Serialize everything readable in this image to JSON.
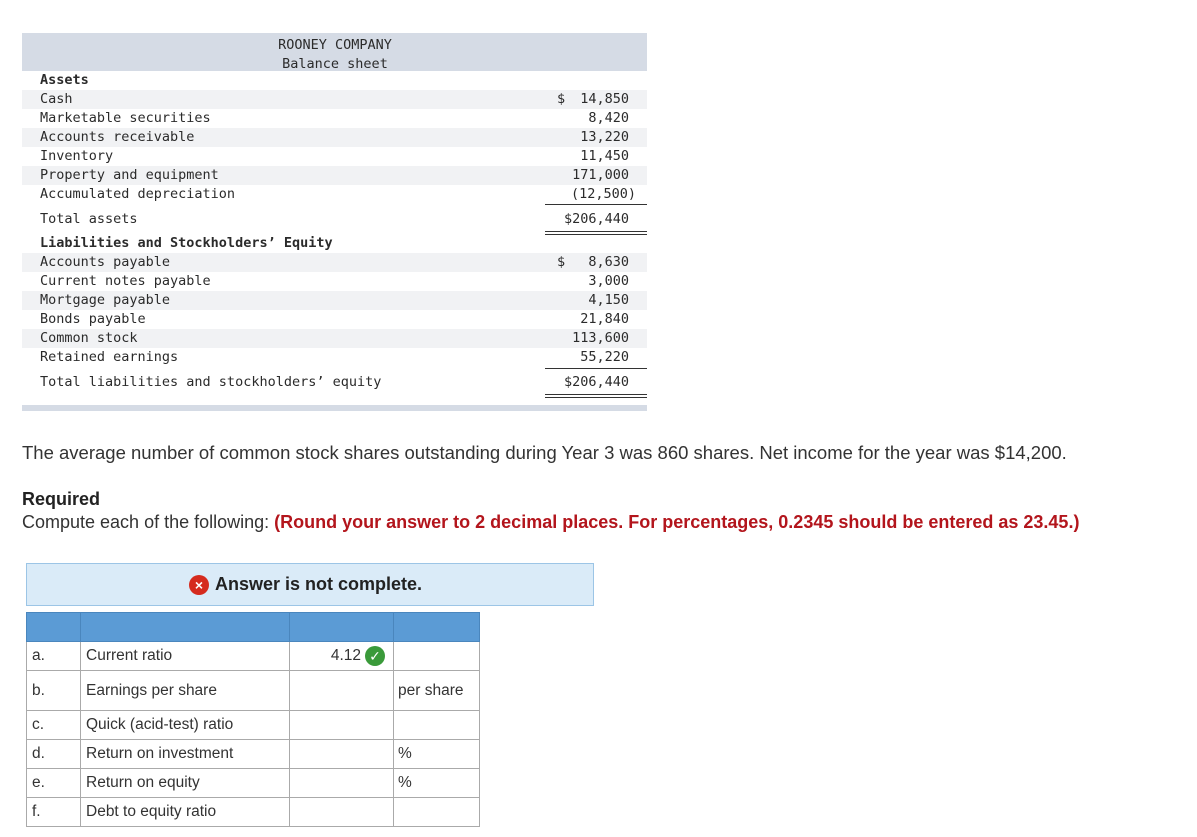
{
  "balance_sheet": {
    "company": "ROONEY COMPANY",
    "subtitle": "Balance sheet",
    "assets_heading": "Assets",
    "assets": [
      {
        "label": "Cash",
        "currency": "$",
        "amount": "14,850"
      },
      {
        "label": "Marketable securities",
        "currency": "",
        "amount": "8,420"
      },
      {
        "label": "Accounts receivable",
        "currency": "",
        "amount": "13,220"
      },
      {
        "label": "Inventory",
        "currency": "",
        "amount": "11,450"
      },
      {
        "label": "Property and equipment",
        "currency": "",
        "amount": "171,000"
      },
      {
        "label": "Accumulated depreciation",
        "currency": "",
        "amount": "(12,500)"
      }
    ],
    "total_assets": {
      "label": "Total assets",
      "amount": "$206,440"
    },
    "liab_heading": "Liabilities and Stockholders’ Equity",
    "liabilities": [
      {
        "label": "Accounts payable",
        "currency": "$",
        "amount": "8,630"
      },
      {
        "label": "Current notes payable",
        "currency": "",
        "amount": "3,000"
      },
      {
        "label": "Mortgage payable",
        "currency": "",
        "amount": "4,150"
      },
      {
        "label": "Bonds payable",
        "currency": "",
        "amount": "21,840"
      },
      {
        "label": "Common stock",
        "currency": "",
        "amount": "113,600"
      },
      {
        "label": "Retained earnings",
        "currency": "",
        "amount": "55,220"
      }
    ],
    "total_liab": {
      "label": "Total liabilities and stockholders’ equity",
      "amount": "$206,440"
    }
  },
  "problem": {
    "paragraph": "The average number of common stock shares outstanding during Year 3 was 860 shares. Net income for the year was $14,200.",
    "required_heading": "Required",
    "required_text": "Compute each of the following: ",
    "required_note": "(Round your answer to 2 decimal places. For percentages, 0.2345 should be entered as 23.45.)"
  },
  "answer": {
    "status": "Answer is not complete.",
    "x_icon": "×",
    "check_icon": "✓",
    "rows": [
      {
        "letter": "a.",
        "name": "Current ratio",
        "value": "4.12",
        "unit": "",
        "correct": true
      },
      {
        "letter": "b.",
        "name": "Earnings per share",
        "value": "",
        "unit": "per share",
        "correct": false
      },
      {
        "letter": "c.",
        "name": "Quick (acid-test) ratio",
        "value": "",
        "unit": "",
        "correct": false
      },
      {
        "letter": "d.",
        "name": "Return on investment",
        "value": "",
        "unit": "%",
        "correct": false
      },
      {
        "letter": "e.",
        "name": "Return on equity",
        "value": "",
        "unit": "%",
        "correct": false
      },
      {
        "letter": "f.",
        "name": "Debt to equity ratio",
        "value": "",
        "unit": "",
        "correct": false
      }
    ]
  }
}
